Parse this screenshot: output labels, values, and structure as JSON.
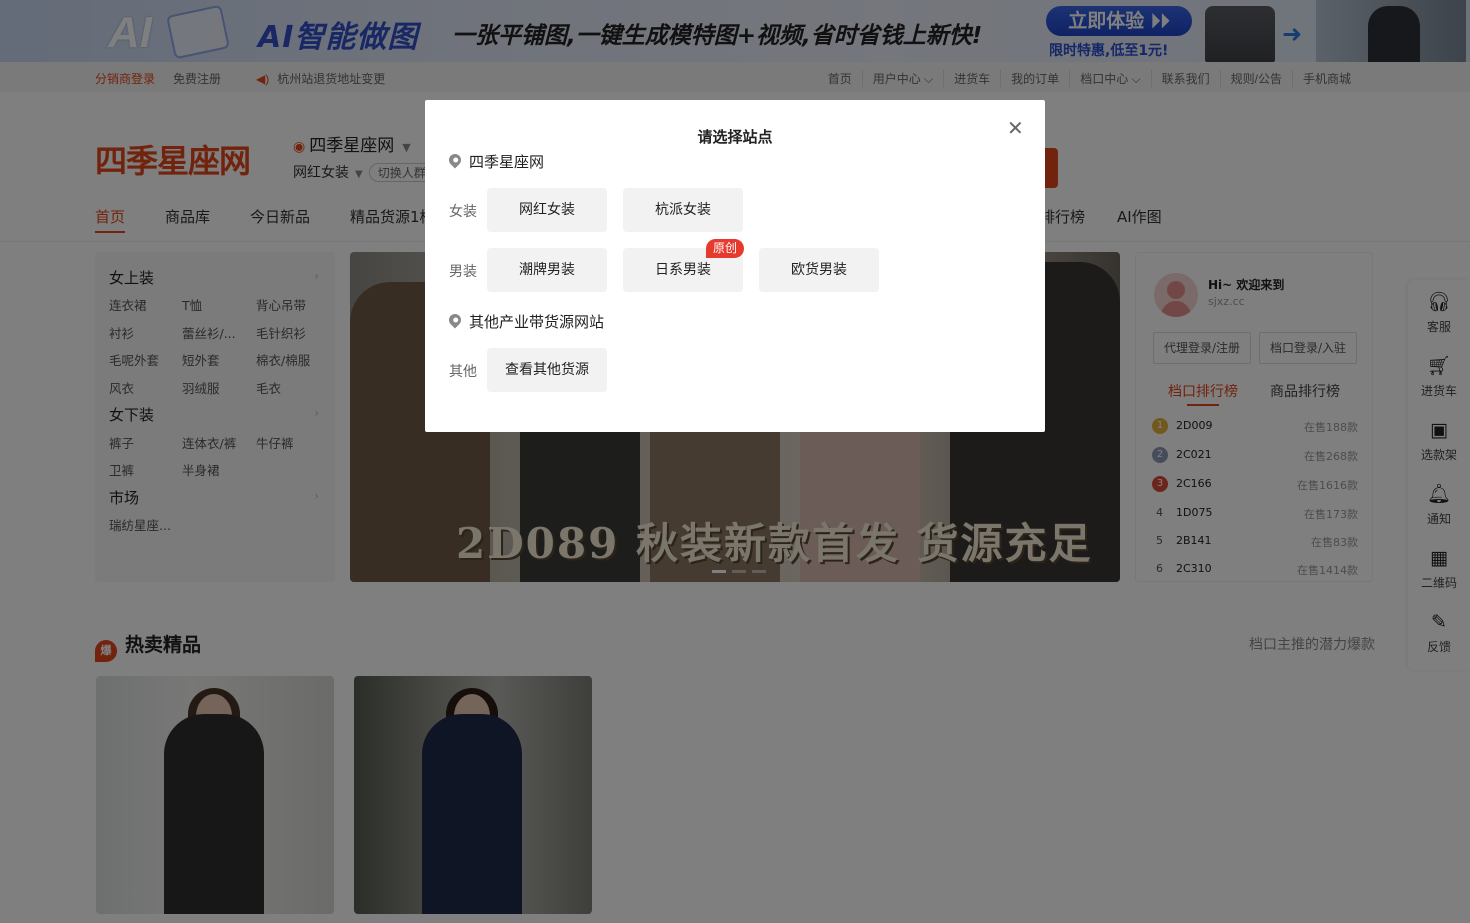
{
  "banner": {
    "ai_logo": "AI",
    "headline_brand": "AI智能做图",
    "headline_text": "一张平铺图,一键生成模特图+视频,省时省钱上新快!",
    "cta": "立即体验 ⏵⏵",
    "promo": "限时特惠,低至1元!"
  },
  "topbar": {
    "distributor_login": "分销商登录",
    "register": "免费注册",
    "notice": "杭州站退货地址变更",
    "links": [
      "首页",
      "用户中心 ⌵",
      "进货车",
      "我的订单",
      "档口中心 ⌵",
      "联系我们",
      "规则/公告",
      "手机商城"
    ]
  },
  "header": {
    "logo": "四季星座网",
    "site_name": "四季星座网",
    "category": "网红女装",
    "switch_label": "切换人群"
  },
  "mainnav": [
    "首页",
    "商品库",
    "今日新品",
    "精品货源1档",
    "排行榜",
    "AI作图"
  ],
  "categories": {
    "groups": [
      {
        "title": "女上装",
        "items": [
          "连衣裙",
          "T恤",
          "背心吊带",
          "衬衫",
          "蕾丝衫/...",
          "毛针织衫",
          "毛呢外套",
          "短外套",
          "棉衣/棉服",
          "风衣",
          "羽绒服",
          "毛衣"
        ]
      },
      {
        "title": "女下装",
        "items": [
          "裤子",
          "连体衣/裤",
          "牛仔裤",
          "卫裤",
          "半身裙"
        ]
      },
      {
        "title": "市场",
        "items": [
          "瑞纺星座..."
        ]
      }
    ]
  },
  "hero": {
    "caption": "2D089 秋装新款首发 货源充足"
  },
  "userpanel": {
    "welcome": "Hi~ 欢迎来到",
    "domain": "sjxz.cc",
    "agent_btn": "代理登录/注册",
    "stall_btn": "档口登录/入驻",
    "tab_stall": "档口排行榜",
    "tab_goods": "商品排行榜",
    "ranking": [
      {
        "rank": "1",
        "code": "2D009",
        "sale": "在售188款"
      },
      {
        "rank": "2",
        "code": "2C021",
        "sale": "在售268款"
      },
      {
        "rank": "3",
        "code": "2C166",
        "sale": "在售1616款"
      },
      {
        "rank": "4",
        "code": "1D075",
        "sale": "在售173款"
      },
      {
        "rank": "5",
        "code": "2B141",
        "sale": "在售83款"
      },
      {
        "rank": "6",
        "code": "2C310",
        "sale": "在售1414款"
      }
    ]
  },
  "hot": {
    "flame": "爆",
    "title": "热卖精品",
    "subtitle": "档口主推的潜力爆款"
  },
  "floattool": [
    "客服",
    "进货车",
    "选款架",
    "通知",
    "二维码",
    "反馈"
  ],
  "modal": {
    "title": "请选择站点",
    "section1": "四季星座网",
    "row_women": "女装",
    "row_men": "男装",
    "women_opts": [
      "网红女装",
      "杭派女装"
    ],
    "men_opts": [
      "潮牌男装",
      "日系男装",
      "欧货男装"
    ],
    "original_tag": "原创",
    "section2": "其他产业带货源网站",
    "row_other": "其他",
    "other_opts": [
      "查看其他货源"
    ],
    "close": "✕"
  },
  "colors": {
    "brand": "#e4471b",
    "overlay": "rgba(0,0,0,0.5)"
  }
}
